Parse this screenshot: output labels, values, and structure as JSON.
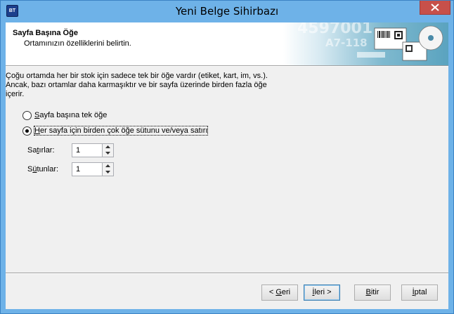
{
  "window": {
    "title": "Yeni Belge Sihirbazı",
    "app_icon_text": "BT"
  },
  "header": {
    "title": "Sayfa Başına Öğe",
    "subtitle": "Ortamınızın özelliklerini belirtin."
  },
  "description": [
    "Çoğu ortamda her bir stok için sadece tek bir öğe vardır (etiket, kart, im, vs.).",
    "Ancak, bazı ortamlar daha karmaşıktır ve bir sayfa üzerinde birden fazla öğe",
    "içerir."
  ],
  "options": [
    {
      "mnemonic": "S",
      "rest": "ayfa başına tek öğe",
      "checked": false
    },
    {
      "mnemonic": "H",
      "rest": "er sayfa için birden çok öğe sütunu ve/veya satırı",
      "checked": true
    }
  ],
  "rows_field": {
    "label_pre": "Sa",
    "label_mnemonic": "t",
    "label_post": "ırlar:",
    "value": "1"
  },
  "cols_field": {
    "label_pre": "S",
    "label_mnemonic": "ü",
    "label_post": "tunlar:",
    "value": "1"
  },
  "buttons": {
    "back": {
      "pre": "< ",
      "mnemonic": "G",
      "post": "eri"
    },
    "next": {
      "pre": "",
      "mnemonic": "İ",
      "post": "leri >"
    },
    "finish": {
      "pre": "",
      "mnemonic": "B",
      "post": "itir"
    },
    "cancel": {
      "pre": "",
      "mnemonic": "İ",
      "post": "ptal"
    }
  },
  "colors": {
    "titlebar": "#6eb2e8",
    "close": "#c7504a",
    "dialog_bg": "#f0f0f0"
  }
}
